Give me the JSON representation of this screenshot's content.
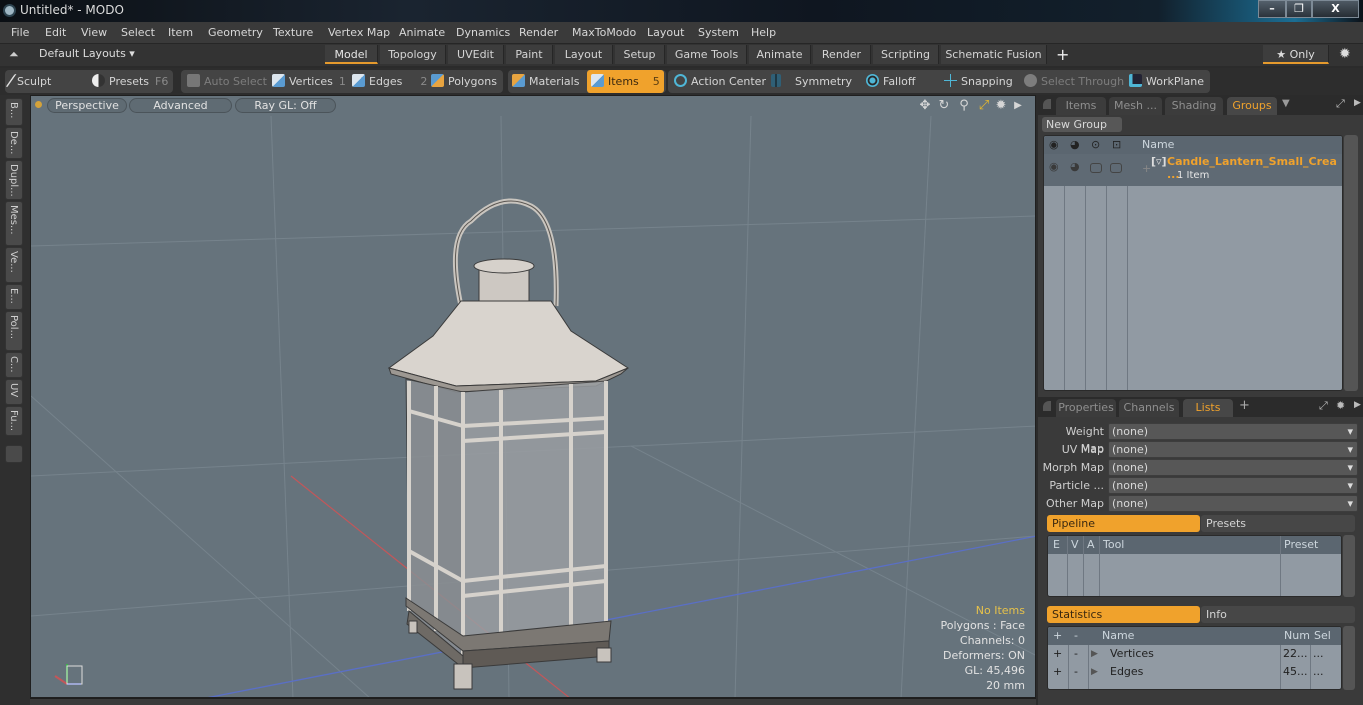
{
  "window": {
    "title": "Untitled* - MODO",
    "controls": {
      "minimize": "–",
      "restore": "❐",
      "close": "X"
    }
  },
  "menu": [
    "File",
    "Edit",
    "View",
    "Select",
    "Item",
    "Geometry",
    "Texture",
    "Vertex Map",
    "Animate",
    "Dynamics",
    "Render",
    "MaxToModo",
    "Layout",
    "System",
    "Help"
  ],
  "layouts": {
    "selector": "Default Layouts ▾",
    "tabs": [
      "Model",
      "Topology",
      "UVEdit",
      "Paint",
      "Layout",
      "Setup",
      "Game Tools",
      "Animate",
      "Render",
      "Scripting",
      "Schematic Fusion"
    ],
    "active_tab": "Model",
    "add": "+",
    "only": "★ Only"
  },
  "toolbar": {
    "sculpt": "Sculpt",
    "presets": "Presets",
    "presets_key": "F6",
    "auto_select": "Auto Select",
    "vertices": "Vertices",
    "vertices_key": "1",
    "edges": "Edges",
    "edges_key": "2",
    "polygons": "Polygons",
    "materials": "Materials",
    "items": "Items",
    "items_key": "5",
    "action_center": "Action Center",
    "symmetry": "Symmetry",
    "falloff": "Falloff",
    "snapping": "Snapping",
    "select_through": "Select Through",
    "workplane": "WorkPlane"
  },
  "left_tabs": [
    "B...",
    "De...",
    "Dupl...",
    "Mes...",
    "Ve...",
    "E...",
    "Pol...",
    "C...",
    "UV",
    "Fu..."
  ],
  "viewport": {
    "view_mode": "Perspective",
    "shading": "Advanced",
    "raygl": "Ray GL: Off",
    "hud": {
      "selection": "No Items",
      "polygons": "Polygons : Face",
      "channels": "Channels: 0",
      "deformers": "Deformers: ON",
      "gl": "GL: 45,496",
      "scale": "20 mm"
    },
    "colors": {
      "background": "#66737c",
      "x_axis": "#c2575a",
      "z_axis": "#5a6fc6"
    }
  },
  "groups_panel": {
    "tabs": [
      "Items",
      "Mesh ...",
      "Shading",
      "Groups"
    ],
    "active_tab": "Groups",
    "new_group": "New Group",
    "column_name": "Name",
    "rows": [
      {
        "name": "Candle_Lantern_Small_Crea ...",
        "sub": "1 Item"
      }
    ]
  },
  "properties_panel": {
    "tabs": [
      "Properties",
      "Channels",
      "Lists"
    ],
    "active_tab": "Lists",
    "add": "+",
    "fields": [
      {
        "label": "Weight Map",
        "value": "(none)"
      },
      {
        "label": "UV Map",
        "value": "(none)"
      },
      {
        "label": "Morph Map",
        "value": "(none)"
      },
      {
        "label": "Particle ...",
        "value": "(none)"
      },
      {
        "label": "Other Map",
        "value": "(none)"
      }
    ]
  },
  "pipeline": {
    "tabs": [
      "Pipeline",
      "Presets"
    ],
    "active_tab": "Pipeline",
    "columns": [
      "E",
      "V",
      "A",
      "Tool",
      "Preset"
    ]
  },
  "statistics": {
    "tabs": [
      "Statistics",
      "Info"
    ],
    "active_tab": "Statistics",
    "columns": [
      "+",
      "-",
      "Name",
      "Num",
      "Sel"
    ],
    "rows": [
      {
        "plus": "+",
        "minus": "-",
        "name": "Vertices",
        "num": "22...",
        "sel": "..."
      },
      {
        "plus": "+",
        "minus": "-",
        "name": "Edges",
        "num": "45...",
        "sel": "..."
      }
    ]
  },
  "accent_color": "#f0a22c"
}
